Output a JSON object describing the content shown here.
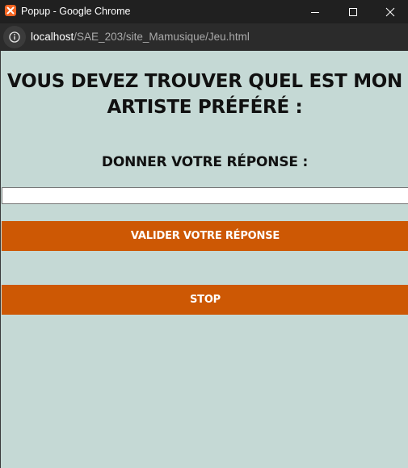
{
  "window": {
    "title": "Popup - Google Chrome",
    "app_icon": "xampp-icon",
    "controls": [
      "minimize-icon",
      "maximize-icon",
      "close-icon"
    ]
  },
  "address_bar": {
    "host": "localhost",
    "path": "/SAE_203/site_Mamusique/Jeu.html",
    "info_icon": "info-icon"
  },
  "page": {
    "heading": "VOUS DEVEZ TROUVER QUEL EST MON ARTISTE PRÉFÉRÉ :",
    "subheading": "DONNER VOTRE RÉPONSE :",
    "answer_input": {
      "value": "",
      "placeholder": ""
    },
    "validate_button": "VALIDER VOTRE RÉPONSE",
    "stop_button": "STOP"
  },
  "colors": {
    "page_background": "#c5d9d5",
    "button_background": "#cd5804",
    "button_text": "#ffffff",
    "titlebar": "#202020",
    "addressbar": "#2b2b2b",
    "app_icon": "#f26522"
  }
}
